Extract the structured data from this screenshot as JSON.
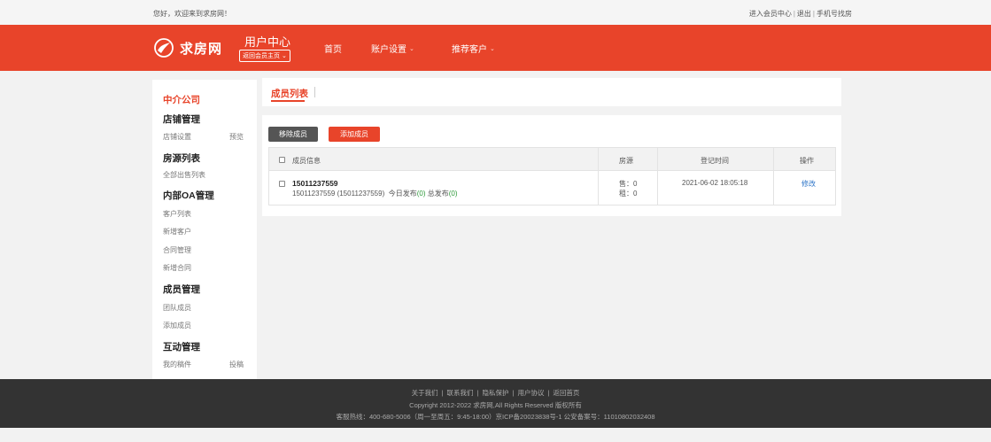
{
  "topbar": {
    "welcome": "您好，欢迎来到求房网！",
    "links": [
      "进入会员中心",
      "退出",
      "手机号找房"
    ]
  },
  "header": {
    "logo_text": "求房网",
    "user_center": "用户中心",
    "back_home": "返回会员主页",
    "nav": [
      {
        "label": "首页",
        "has_dropdown": false
      },
      {
        "label": "账户设置",
        "has_dropdown": true
      },
      {
        "label": "推荐客户",
        "has_dropdown": true
      }
    ],
    "brand_color": "#e8442a"
  },
  "sidebar": {
    "title": "中介公司",
    "sections": [
      {
        "heading": "店铺管理",
        "items": [
          "店铺设置"
        ],
        "extra": "预览"
      },
      {
        "heading": "房源列表",
        "items": [
          "全部出售列表"
        ]
      },
      {
        "heading": "内部OA管理",
        "items": [
          "客户列表",
          "新增客户",
          "合同管理",
          "新增合同"
        ]
      },
      {
        "heading": "成员管理",
        "items": [
          "团队成员",
          "添加成员"
        ]
      },
      {
        "heading": "互动管理",
        "items": [
          "我的稿件"
        ],
        "extra": "投稿"
      }
    ]
  },
  "main": {
    "tab": "成员列表",
    "buttons": {
      "remove": "移除成员",
      "add": "添加成员"
    },
    "table": {
      "headers": [
        "成员信息",
        "房源",
        "登记时间",
        "操作"
      ],
      "rows": [
        {
          "name": "15011237559",
          "detail": "15011237559 (15011237559)",
          "today_label": "今日发布",
          "today_count": "(0)",
          "total_label": "总发布",
          "total_count": "(0)",
          "sale": "售：0",
          "rent": "租：0",
          "time": "2021-06-02 18:05:18",
          "action": "修改"
        }
      ]
    }
  },
  "footer": {
    "links": [
      "关于我们",
      "联系我们",
      "隐私保护",
      "用户协议",
      "返回首页"
    ],
    "copyright": "Copyright 2012-2022 求房网,All Rights Reserved 版权所有",
    "contact": "客服热线：400-680-5006（周一至周五：9:45-18:00）京ICP备20023838号-1  公安备案号：11010802032408"
  }
}
